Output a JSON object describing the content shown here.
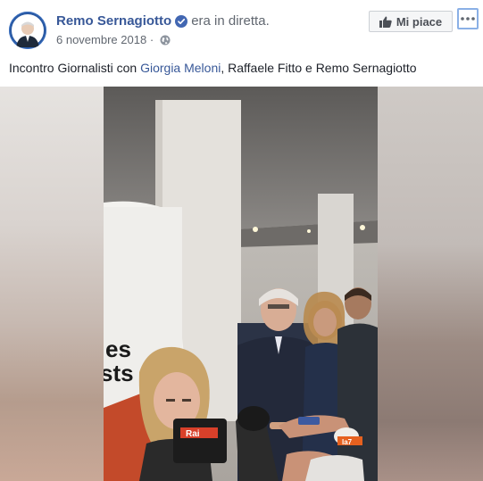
{
  "post": {
    "author": "Remo Sernagiotto",
    "activity": "era in diretta.",
    "date": "6 novembre 2018",
    "separator": "·",
    "text_before": "Incontro Giornalisti con ",
    "tagged": "Giorgia Meloni",
    "text_after": ", Raffaele Fitto e Remo Sernagiotto"
  },
  "actions": {
    "like_label": "Mi piace"
  },
  "video": {
    "background_text_top": "es",
    "background_text_bottom": "sts",
    "mic_label_left": "Rai",
    "mic_label_right": "la7"
  },
  "colors": {
    "link": "#385898",
    "text": "#1d2129",
    "secondary": "#616770",
    "verified": "#4267b2"
  },
  "icons": {
    "verified": "verified-badge-icon",
    "privacy": "globe-icon",
    "like": "thumbs-up-icon",
    "more": "more-dots-icon"
  }
}
